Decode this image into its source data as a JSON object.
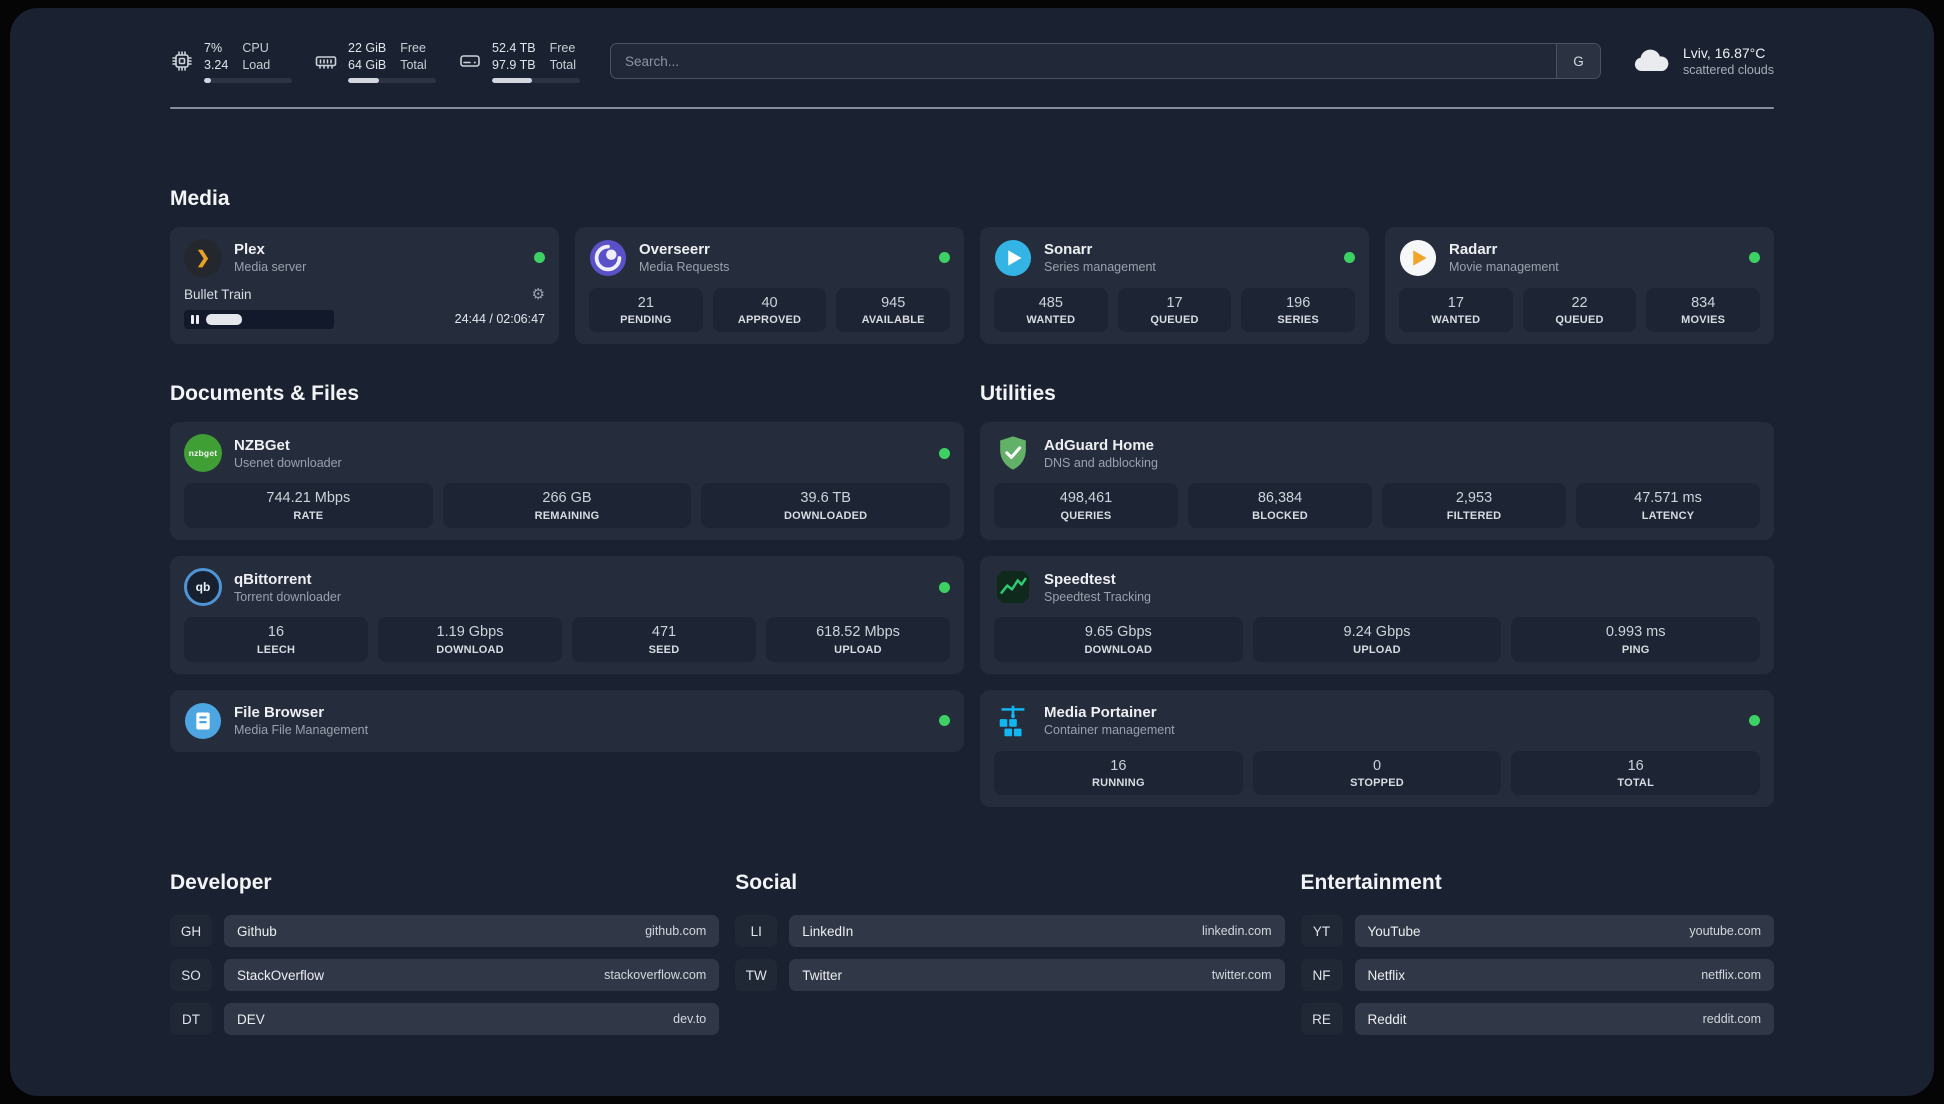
{
  "topbar": {
    "cpu": {
      "value": "7%",
      "value2": "3.24",
      "label": "CPU",
      "label2": "Load",
      "progress_pct": 8
    },
    "memory": {
      "value": "22 GiB",
      "value2": "64 GiB",
      "label": "Free",
      "label2": "Total",
      "progress_pct": 35
    },
    "disk": {
      "value": "52.4 TB",
      "value2": "97.9 TB",
      "label": "Free",
      "label2": "Total",
      "progress_pct": 46
    },
    "search": {
      "placeholder": "Search...",
      "button_label": "G"
    },
    "weather": {
      "location": "Lviv, 16.87°C",
      "condition": "scattered clouds"
    }
  },
  "sections": {
    "media": {
      "heading": "Media",
      "plex": {
        "title": "Plex",
        "subtitle": "Media server",
        "now_playing": "Bullet Train",
        "elapsed": "24:44 / 02:06:47",
        "progress_pct": 30
      },
      "overseerr": {
        "title": "Overseerr",
        "subtitle": "Media Requests",
        "stats": [
          {
            "value": "21",
            "label": "PENDING"
          },
          {
            "value": "40",
            "label": "APPROVED"
          },
          {
            "value": "945",
            "label": "AVAILABLE"
          }
        ]
      },
      "sonarr": {
        "title": "Sonarr",
        "subtitle": "Series management",
        "stats": [
          {
            "value": "485",
            "label": "WANTED"
          },
          {
            "value": "17",
            "label": "QUEUED"
          },
          {
            "value": "196",
            "label": "SERIES"
          }
        ]
      },
      "radarr": {
        "title": "Radarr",
        "subtitle": "Movie management",
        "stats": [
          {
            "value": "17",
            "label": "WANTED"
          },
          {
            "value": "22",
            "label": "QUEUED"
          },
          {
            "value": "834",
            "label": "MOVIES"
          }
        ]
      }
    },
    "documents": {
      "heading": "Documents & Files",
      "nzbget": {
        "title": "NZBGet",
        "subtitle": "Usenet downloader",
        "stats": [
          {
            "value": "744.21 Mbps",
            "label": "RATE"
          },
          {
            "value": "266 GB",
            "label": "REMAINING"
          },
          {
            "value": "39.6 TB",
            "label": "DOWNLOADED"
          }
        ]
      },
      "qbittorrent": {
        "title": "qBittorrent",
        "subtitle": "Torrent downloader",
        "stats": [
          {
            "value": "16",
            "label": "LEECH"
          },
          {
            "value": "1.19 Gbps",
            "label": "DOWNLOAD"
          },
          {
            "value": "471",
            "label": "SEED"
          },
          {
            "value": "618.52 Mbps",
            "label": "UPLOAD"
          }
        ]
      },
      "filebrowser": {
        "title": "File Browser",
        "subtitle": "Media File Management"
      }
    },
    "utilities": {
      "heading": "Utilities",
      "adguard": {
        "title": "AdGuard Home",
        "subtitle": "DNS and adblocking",
        "stats": [
          {
            "value": "498,461",
            "label": "QUERIES"
          },
          {
            "value": "86,384",
            "label": "BLOCKED"
          },
          {
            "value": "2,953",
            "label": "FILTERED"
          },
          {
            "value": "47.571 ms",
            "label": "LATENCY"
          }
        ]
      },
      "speedtest": {
        "title": "Speedtest",
        "subtitle": "Speedtest Tracking",
        "stats": [
          {
            "value": "9.65 Gbps",
            "label": "DOWNLOAD"
          },
          {
            "value": "9.24 Gbps",
            "label": "UPLOAD"
          },
          {
            "value": "0.993 ms",
            "label": "PING"
          }
        ]
      },
      "portainer": {
        "title": "Media Portainer",
        "subtitle": "Container management",
        "stats": [
          {
            "value": "16",
            "label": "RUNNING"
          },
          {
            "value": "0",
            "label": "STOPPED"
          },
          {
            "value": "16",
            "label": "TOTAL"
          }
        ]
      }
    },
    "bookmarks": {
      "developer": {
        "heading": "Developer",
        "items": [
          {
            "abbr": "GH",
            "name": "Github",
            "url": "github.com"
          },
          {
            "abbr": "SO",
            "name": "StackOverflow",
            "url": "stackoverflow.com"
          },
          {
            "abbr": "DT",
            "name": "DEV",
            "url": "dev.to"
          }
        ]
      },
      "social": {
        "heading": "Social",
        "items": [
          {
            "abbr": "LI",
            "name": "LinkedIn",
            "url": "linkedin.com"
          },
          {
            "abbr": "TW",
            "name": "Twitter",
            "url": "twitter.com"
          }
        ]
      },
      "entertainment": {
        "heading": "Entertainment",
        "items": [
          {
            "abbr": "YT",
            "name": "YouTube",
            "url": "youtube.com"
          },
          {
            "abbr": "NF",
            "name": "Netflix",
            "url": "netflix.com"
          },
          {
            "abbr": "RE",
            "name": "Reddit",
            "url": "reddit.com"
          }
        ]
      }
    }
  },
  "colors": {
    "status_online": "#3dd164",
    "plex_accent": "#e8a325",
    "overseerr_accent": "#5a50c8",
    "sonarr_accent": "#33b4e4",
    "radarr_accent": "#f0a42a",
    "nzbget_accent": "#3f9e34",
    "qbittorrent_accent": "#4f94d4",
    "adguard_accent": "#63b168",
    "speedtest_accent": "#2ecb72",
    "portainer_accent": "#10b7f2"
  }
}
